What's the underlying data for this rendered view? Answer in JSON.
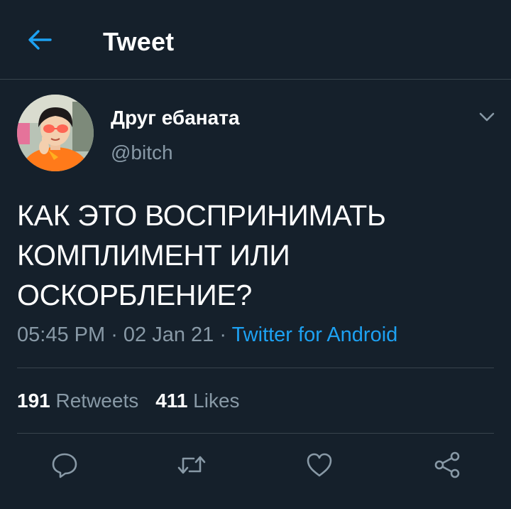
{
  "header": {
    "title": "Tweet"
  },
  "author": {
    "display_name": "Друг ебаната",
    "handle": "@bitch"
  },
  "tweet": {
    "text": "КАК ЭТО ВОСПРИНИМАТЬ КОМПЛИМЕНТ ИЛИ ОСКОРБЛЕНИЕ?",
    "time": "05:45 PM",
    "separator": " · ",
    "date": "02 Jan 21",
    "source": "Twitter for Android"
  },
  "stats": {
    "retweets_count": "191",
    "retweets_label": "Retweets",
    "likes_count": "411",
    "likes_label": "Likes"
  },
  "icons": {
    "back": "arrow-left-icon",
    "caret": "chevron-down-icon",
    "reply": "reply-icon",
    "retweet": "retweet-icon",
    "like": "heart-icon",
    "share": "share-icon"
  },
  "colors": {
    "background": "#15202b",
    "accent": "#1da1f2",
    "secondary_text": "#8899a6",
    "divider": "#38444d"
  }
}
